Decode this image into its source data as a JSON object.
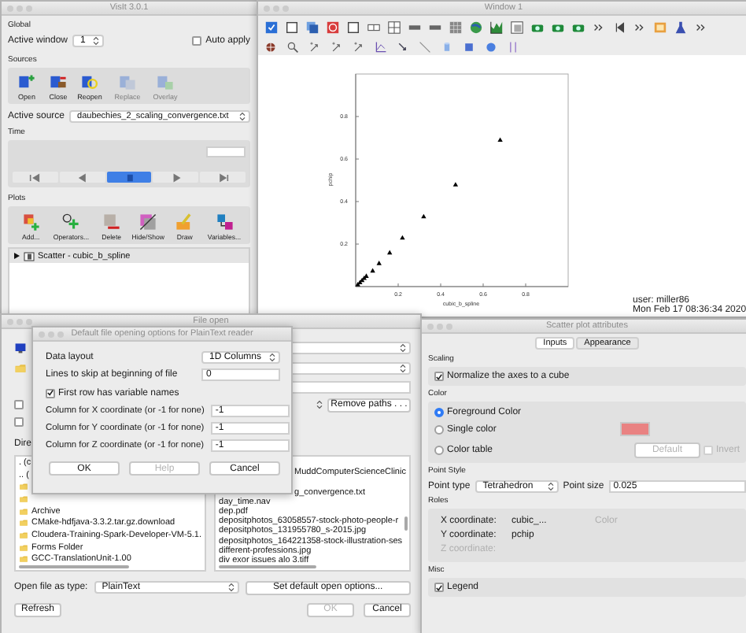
{
  "visit": {
    "title": "VisIt 3.0.1",
    "global_heading": "Global",
    "active_window_label": "Active window",
    "active_window": "1",
    "auto_apply": {
      "label": "Auto apply",
      "checked": false
    },
    "sources_heading": "Sources",
    "source_buttons": [
      {
        "label": "Open",
        "disabled": false
      },
      {
        "label": "Close",
        "disabled": false
      },
      {
        "label": "Reopen",
        "disabled": false
      },
      {
        "label": "Replace",
        "disabled": true
      },
      {
        "label": "Overlay",
        "disabled": true
      }
    ],
    "active_source_label": "Active source",
    "active_source": "daubechies_2_scaling_convergence.txt",
    "time_heading": "Time",
    "plots_heading": "Plots",
    "plot_buttons": [
      "Add...",
      "Operators...",
      "Delete",
      "Hide/Show",
      "Draw",
      "Variables..."
    ],
    "plot_items": [
      {
        "label": "Scatter - cubic_b_spline",
        "expanded": false
      }
    ]
  },
  "viz": {
    "title": "Window 1",
    "chart_data": {
      "type": "scatter",
      "xlabel": "cubic_b_spline",
      "ylabel": "pchip",
      "xlim": [
        0,
        1
      ],
      "ylim": [
        0,
        1
      ],
      "xticks": [
        0.2,
        0.4,
        0.6,
        0.8
      ],
      "yticks": [
        0.2,
        0.4,
        0.6,
        0.8
      ],
      "x": [
        0.68,
        0.47,
        0.32,
        0.22,
        0.16,
        0.11,
        0.08,
        0.05,
        0.04,
        0.03,
        0.02,
        0.01
      ],
      "series": [
        {
          "color": "#000000",
          "values": [
            0.69,
            0.48,
            0.33,
            0.23,
            0.16,
            0.11,
            0.075,
            0.05,
            0.04,
            0.03,
            0.02,
            0.01
          ]
        }
      ]
    },
    "user": "user: miller86",
    "timestamp": "Mon Feb 17 08:36:34 2020"
  },
  "file_open": {
    "title": "File open",
    "path_checkboxes": [
      {
        "checked": false
      },
      {
        "checked": false
      }
    ],
    "remove_paths": "Remove paths . . .",
    "directory_label": "Dire",
    "folders": [
      {
        "kind": "text",
        "name": ". (c"
      },
      {
        "kind": "text",
        "name": ".. ("
      },
      {
        "kind": "covered"
      },
      {
        "kind": "covered"
      },
      {
        "kind": "folder",
        "name": "Archive"
      },
      {
        "kind": "folder",
        "name": "CMake-hdfjava-3.3.2.tar.gz.download"
      },
      {
        "kind": "folder",
        "name": "Cloudera-Training-Spark-Developer-VM-5.1."
      },
      {
        "kind": "folder",
        "name": "Forms Folder"
      },
      {
        "kind": "folder",
        "name": "GCC-TranslationUnit-1.00"
      }
    ],
    "files": [
      {
        "kind": "covered"
      },
      {
        "kind": "partial",
        "name": "MuddComputerScienceClinic"
      },
      {
        "kind": "covered"
      },
      {
        "kind": "partial",
        "name": "g_convergence.txt"
      },
      {
        "kind": "file",
        "name": "day_time.nav"
      },
      {
        "kind": "file",
        "name": "dep.pdf"
      },
      {
        "kind": "file",
        "name": "depositphotos_63058557-stock-photo-people-r"
      },
      {
        "kind": "file",
        "name": "depositphotos_131955780_s-2015.jpg"
      },
      {
        "kind": "file",
        "name": "depositphotos_164221358-stock-illustration-ses"
      },
      {
        "kind": "file",
        "name": "different-professions.jpg"
      },
      {
        "kind": "file",
        "name": "div exor issues alo 3.tiff"
      }
    ],
    "file_type_label": "Open file as type:",
    "file_type": "PlainText",
    "set_default": "Set default open options...",
    "refresh": "Refresh",
    "buttons": [
      {
        "label": "OK",
        "disabled": true
      },
      {
        "label": "Cancel",
        "disabled": false
      }
    ]
  },
  "dialog": {
    "title": "Default file opening options for PlainText reader",
    "data_layout_label": "Data layout",
    "data_layout": "1D Columns",
    "lines_label": "Lines to skip at beginning of file",
    "lines": "0",
    "first_row": {
      "label": "First row has variable names",
      "checked": true
    },
    "columns": [
      {
        "label": "Column for X coordinate (or -1 for none)",
        "value": "-1"
      },
      {
        "label": "Column for Y coordinate (or -1 for none)",
        "value": "-1"
      },
      {
        "label": "Column for Z coordinate (or -1 for none)",
        "value": "-1"
      }
    ],
    "buttons": [
      {
        "label": "OK",
        "disabled": false
      },
      {
        "label": "Help",
        "disabled": true
      },
      {
        "label": "Cancel",
        "disabled": false
      }
    ]
  },
  "scatter": {
    "title": "Scatter plot attributes",
    "tabs": [
      {
        "label": "Inputs",
        "selected": true
      },
      {
        "label": "Appearance",
        "selected": false
      }
    ],
    "scaling_heading": "Scaling",
    "normalize": {
      "label": "Normalize the axes to a cube",
      "checked": true
    },
    "color_heading": "Color",
    "color_modes": [
      {
        "label": "Foreground Color",
        "selected": true
      },
      {
        "label": "Single color",
        "selected": false
      },
      {
        "label": "Color table",
        "selected": false
      }
    ],
    "swatch": {
      "color": "#e98282"
    },
    "default_button": {
      "label": "Default",
      "disabled": true
    },
    "invert": {
      "label": "Invert",
      "checked": false,
      "disabled": true
    },
    "point_style_heading": "Point Style",
    "point_type_label": "Point type",
    "point_type": "Tetrahedron",
    "point_size_label": "Point size",
    "point_size": "0.025",
    "roles_heading": "Roles",
    "roles": [
      {
        "label": "X coordinate:",
        "value": "cubic_...",
        "disabled": false
      },
      {
        "label": "Y coordinate:",
        "value": "pchip",
        "disabled": false
      },
      {
        "label": "Z coordinate:",
        "disabled": true
      }
    ],
    "color_role": {
      "label": "Color",
      "disabled": true
    },
    "misc_heading": "Misc",
    "legend": {
      "label": "Legend",
      "checked": true
    }
  }
}
